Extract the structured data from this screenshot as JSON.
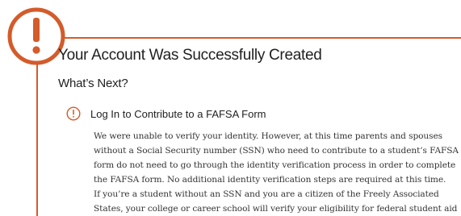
{
  "colors": {
    "accent": "#d45b2a",
    "text": "#1f1f1f",
    "body_text": "#333333",
    "background": "#ffffff"
  },
  "icons": {
    "badge": "exclamation-circle-icon",
    "task": "exclamation-circle-icon"
  },
  "header": {
    "title": "Your Account Was Successfully Created"
  },
  "next": {
    "heading": "What’s Next?"
  },
  "task": {
    "title": "Log In to Contribute to a FAFSA Form"
  },
  "paragraphs": {
    "p1": [
      "We were unable to verify your identity. However, at this time parents and spouses",
      "without a Social Security number (SSN) who need to contribute to a student’s FAFSA",
      "form do not need to go through the identity verification process in order to complete",
      "the FAFSA form. No additional identity verification steps are required at this time."
    ],
    "p2": [
      "If you’re a student without an SSN and you are a citizen of the Freely Associated",
      "States, your college or career school will verify your eligibility for federal student aid"
    ]
  }
}
